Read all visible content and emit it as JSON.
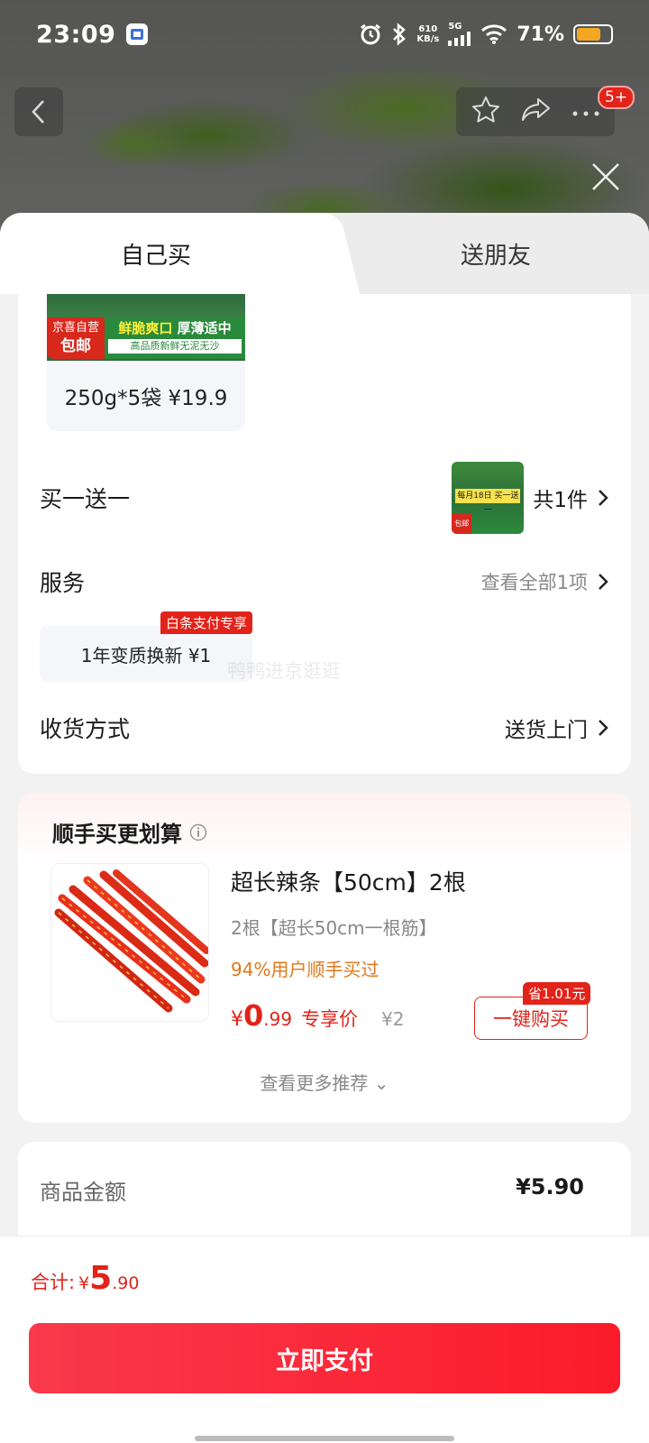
{
  "status_bar": {
    "time": "23:09",
    "network_speed_top": "610",
    "network_speed_bottom": "KB/s",
    "network_type": "5G",
    "battery": "71%",
    "icons": [
      "alarm-icon",
      "bluetooth-icon",
      "signal-icon",
      "wifi-icon",
      "battery-icon"
    ]
  },
  "top_nav": {
    "badge": "5+",
    "icons": [
      "back-icon",
      "star-icon",
      "share-icon",
      "more-icon",
      "close-icon"
    ]
  },
  "tabs": {
    "self": "自己买",
    "friend": "送朋友"
  },
  "spec": {
    "badge_store": "京喜自营",
    "badge_free": "包邮",
    "slogan_1": "鲜脆爽口",
    "slogan_2": "厚薄适中",
    "slogan_small": "高品质新鲜无泥无沙",
    "label": "250g*5袋 ¥19.9"
  },
  "promo_row": {
    "label": "买一送一",
    "mini_tag": "每月18日 买一送一",
    "mini_free": "包邮",
    "count": "共1件"
  },
  "service_row": {
    "label": "服务",
    "link": "查看全部1项",
    "chip": "1年变质换新  ¥1",
    "chip_tag": "白条支付专享"
  },
  "watermark": "鸭鸭进京逛逛",
  "delivery_row": {
    "label": "收货方式",
    "value": "送货上门"
  },
  "recommend": {
    "title": "顺手买更划算",
    "name": "超长辣条【50cm】2根",
    "sub": "2根【超长50cm一根筋】",
    "stat": "94%用户顺手买过",
    "price_currency": "¥",
    "price_int": "0",
    "price_dec": ".99",
    "price_label": "专享价",
    "orig_price": "¥2",
    "save_tag": "省1.01元",
    "buy_button": "一键购买",
    "more": "查看更多推荐 ⌄"
  },
  "amount": {
    "label": "商品金额",
    "value": "¥5.90"
  },
  "bottom": {
    "total_label": "合计:",
    "total_currency": "¥",
    "total_int": "5",
    "total_dec": ".90",
    "pay_button": "立即支付"
  },
  "colors": {
    "accent_red": "#e2231a",
    "pay_button": "#fb1b2a",
    "stat_orange": "#e0781a",
    "battery": "#f5a623"
  }
}
